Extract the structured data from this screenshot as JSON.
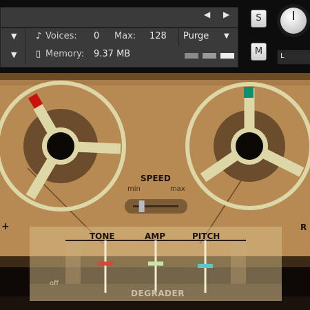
{
  "header": {
    "voices_label": "Voices:",
    "voices_value": "0",
    "max_label": "Max:",
    "max_value": "128",
    "purge_label": "Purge",
    "memory_label": "Memory:",
    "memory_value": "9.37 MB",
    "solo_label": "S",
    "mute_label": "M",
    "pan_label": "L"
  },
  "instrument": {
    "speed_label": "SPEED",
    "speed_min": "min",
    "speed_max": "max",
    "degrader": {
      "title": "DEGRADER",
      "tone_label": "TONE",
      "amp_label": "AMP",
      "pitch_label": "PITCH",
      "off_label": "off"
    },
    "side_left": "+",
    "side_right": "R"
  },
  "colors": {
    "panel": "#b68a52",
    "reel": "#ddd7a8",
    "reel_hub": "#6b4c2c",
    "left_marker": "#c8120f",
    "right_marker": "#0f8f6e",
    "tone_slider": "#d8483a",
    "amp_slider": "#c9e6a8",
    "pitch_slider": "#5fc6c6"
  },
  "controls": {
    "speed_level": 0.15,
    "tone_level": 0.55,
    "amp_level": 0.55,
    "pitch_level": 0.5
  }
}
